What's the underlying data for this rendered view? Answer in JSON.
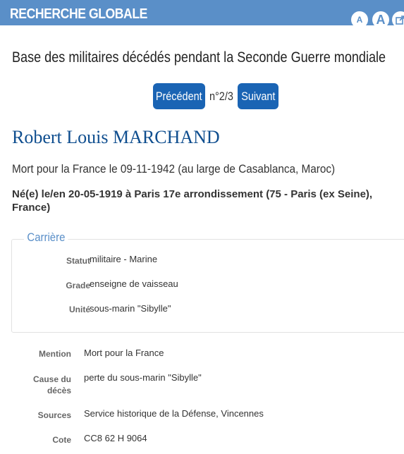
{
  "header": {
    "title": "RECHERCHE GLOBALE",
    "font_small_label": "A",
    "font_large_label": "A",
    "share_icon": "share-icon"
  },
  "page": {
    "database_title": "Base des militaires décédés pendant la Seconde Guerre mondiale",
    "pager": {
      "prev_label": "Précédent",
      "count": "n°2/3",
      "next_label": "Suivant"
    }
  },
  "person": {
    "name": "Robert Louis MARCHAND",
    "death": "Mort pour la France le 09-11-1942 (au large de Casablanca, Maroc)",
    "birth": "Né(e) le/en 20-05-1919 à Paris 17e arrondissement (75 - Paris (ex Seine), France)"
  },
  "career": {
    "legend": "Carrière",
    "rows": [
      {
        "label": "Statut",
        "value": "militaire - Marine"
      },
      {
        "label": "Grade",
        "value": "enseigne de vaisseau"
      },
      {
        "label": "Unité",
        "value": "sous-marin \"Sibylle\""
      }
    ]
  },
  "details": [
    {
      "label": "Mention",
      "value": "Mort pour la France"
    },
    {
      "label": "Cause du décès",
      "value": "perte du sous-marin \"Sibylle\""
    },
    {
      "label": "Sources",
      "value": "Service historique de la Défense, Vincennes"
    },
    {
      "label": "Cote",
      "value": "CC8 62 H 9064"
    }
  ],
  "colors": {
    "header_bg": "#5a8fc8",
    "button_bg": "#1a64b4",
    "name_color": "#0f4e8f"
  }
}
